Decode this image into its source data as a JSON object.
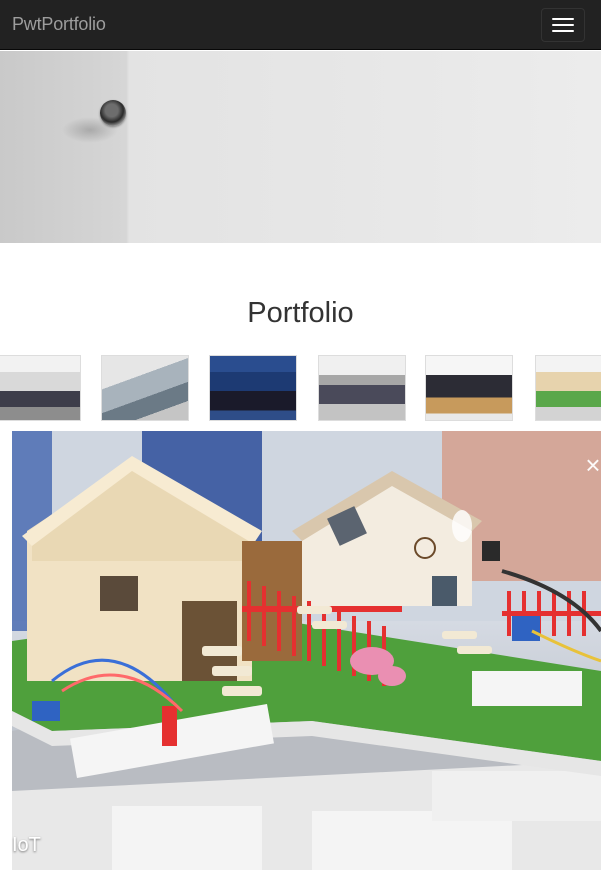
{
  "navbar": {
    "brand": "PwtPortfolio",
    "toggle_icon": "hamburger-menu-icon"
  },
  "portfolio": {
    "title": "Portfolio"
  },
  "lightbox": {
    "caption": "IoT",
    "close_glyph": "×"
  },
  "colors": {
    "navbar_bg": "#222222",
    "brand_text": "#9d9d9d"
  }
}
